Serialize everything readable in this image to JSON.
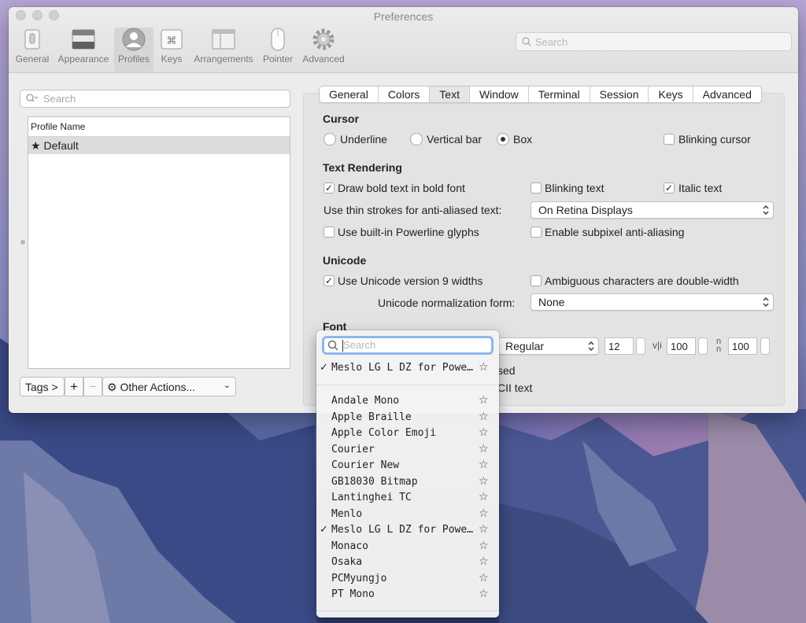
{
  "window": {
    "title": "Preferences"
  },
  "toolbar": {
    "items": [
      {
        "label": "General",
        "icon": "switch-icon"
      },
      {
        "label": "Appearance",
        "icon": "window-icon"
      },
      {
        "label": "Profiles",
        "icon": "person-icon"
      },
      {
        "label": "Keys",
        "icon": "command-key-icon"
      },
      {
        "label": "Arrangements",
        "icon": "arrangements-icon"
      },
      {
        "label": "Pointer",
        "icon": "mouse-icon"
      },
      {
        "label": "Advanced",
        "icon": "gear-icon"
      }
    ],
    "selected": "Profiles",
    "search_placeholder": "Search"
  },
  "profiles": {
    "search_placeholder": "Search",
    "column_header": "Profile Name",
    "rows": [
      {
        "name": "Default",
        "is_default": true
      }
    ],
    "tags_button": "Tags >",
    "add_button": "+",
    "remove_button": "−",
    "other_actions": "Other Actions..."
  },
  "tabs": [
    "General",
    "Colors",
    "Text",
    "Window",
    "Terminal",
    "Session",
    "Keys",
    "Advanced"
  ],
  "active_tab": "Text",
  "cursor": {
    "heading": "Cursor",
    "underline": "Underline",
    "vertical_bar": "Vertical bar",
    "box": "Box",
    "selected": "Box",
    "blinking_cursor": "Blinking cursor",
    "blinking_cursor_checked": false
  },
  "text_rendering": {
    "heading": "Text Rendering",
    "draw_bold": "Draw bold text in bold font",
    "draw_bold_checked": true,
    "blinking_text": "Blinking text",
    "blinking_text_checked": false,
    "italic_text": "Italic text",
    "italic_text_checked": true,
    "thin_strokes_label": "Use thin strokes for anti-aliased text:",
    "thin_strokes_value": "On Retina Displays",
    "powerline": "Use built-in Powerline glyphs",
    "powerline_checked": false,
    "subpixel": "Enable subpixel anti-aliasing",
    "subpixel_checked": false
  },
  "unicode": {
    "heading": "Unicode",
    "version9": "Use Unicode version 9 widths",
    "version9_checked": true,
    "ambiguous": "Ambiguous characters are double-width",
    "ambiguous_checked": false,
    "normalization_label": "Unicode normalization form:",
    "normalization_value": "None"
  },
  "font": {
    "heading": "Font",
    "style": "Regular",
    "size": "12",
    "h_spacing": "100",
    "v_spacing": "100",
    "partial_label_1": "sed",
    "partial_label_2": "CII text"
  },
  "font_menu": {
    "search_placeholder": "Search",
    "current": "Meslo LG L DZ for Powe…",
    "fonts": [
      {
        "name": "Andale Mono",
        "checked": false
      },
      {
        "name": "Apple Braille",
        "checked": false
      },
      {
        "name": "Apple  Color  Emoji",
        "checked": false
      },
      {
        "name": "Courier",
        "checked": false
      },
      {
        "name": "Courier New",
        "checked": false
      },
      {
        "name": "GB18030  Bitmap",
        "checked": false
      },
      {
        "name": "Lantinghei TC",
        "checked": false
      },
      {
        "name": "Menlo",
        "checked": false
      },
      {
        "name": "Meslo LG L DZ for Powe…",
        "checked": true
      },
      {
        "name": "Monaco",
        "checked": false
      },
      {
        "name": "Osaka",
        "checked": false
      },
      {
        "name": "PCMyungjo",
        "checked": false
      },
      {
        "name": "PT Mono",
        "checked": false
      }
    ]
  }
}
